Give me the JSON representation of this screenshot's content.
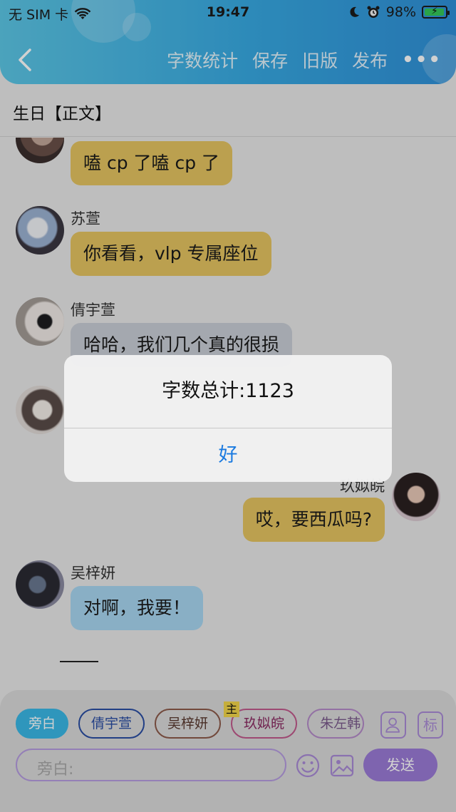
{
  "status_bar": {
    "carrier": "无 SIM 卡",
    "time": "19:47",
    "battery": "98%",
    "battery_level": 0.98
  },
  "nav": {
    "actions": [
      "字数统计",
      "保存",
      "旧版",
      "发布"
    ],
    "more": "•••"
  },
  "title": "生日【正文】",
  "messages": [
    {
      "sender": "",
      "text": "嗑 cp 了嗑 cp 了",
      "side": "left",
      "color": "yellow"
    },
    {
      "sender": "苏萱",
      "text": "你看看，vlp 专属座位",
      "side": "left",
      "color": "yellow"
    },
    {
      "sender": "倩宇萱",
      "text": "哈哈，我们几个真的很损",
      "side": "left",
      "color": "gray"
    },
    {
      "sender": "玖姒皖",
      "text": "哎，要西瓜吗?",
      "side": "right",
      "color": "yellow"
    },
    {
      "sender": "吴梓妍",
      "text": "对啊，我要！",
      "side": "left",
      "color": "blue"
    }
  ],
  "alert": {
    "message": "字数总计:1123",
    "button": "好"
  },
  "composer": {
    "chips": [
      {
        "label": "旁白",
        "active": true
      },
      {
        "label": "倩宇萱"
      },
      {
        "label": "吴梓妍"
      },
      {
        "label": "玖姒皖",
        "badge": "主"
      },
      {
        "label": "朱左韩"
      }
    ],
    "tag_icon": "标",
    "placeholder": "旁白:",
    "send": "发送"
  }
}
